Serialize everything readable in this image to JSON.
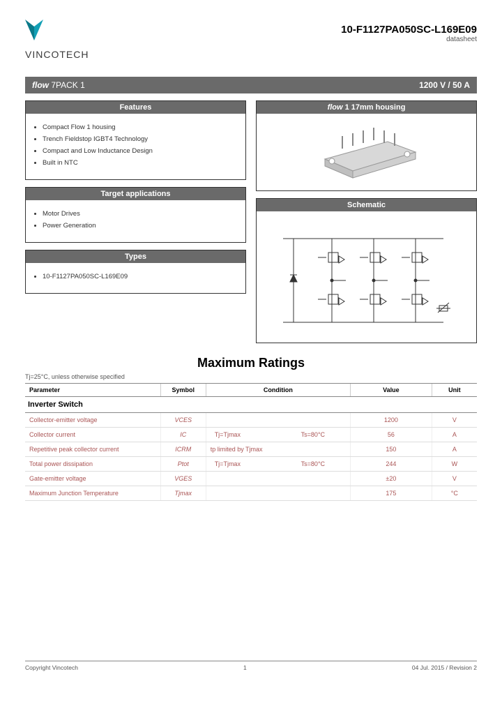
{
  "brand": "VINCOTECH",
  "part_number": "10-F1127PA050SC-L169E09",
  "doc_type": "datasheet",
  "banner": {
    "product_line": "flow 7PACK 1",
    "rating": "1200 V / 50 A"
  },
  "boxes": {
    "features": {
      "title": "Features",
      "items": [
        "Compact Flow 1 housing",
        "Trench Fieldstop IGBT4 Technology",
        "Compact and Low Inductance Design",
        "Built in NTC"
      ]
    },
    "target_apps": {
      "title": "Target applications",
      "items": [
        "Motor Drives",
        "Power Generation"
      ]
    },
    "types": {
      "title": "Types",
      "items": [
        "10-F1127PA050SC-L169E09"
      ]
    },
    "housing": {
      "title": "flow 1 17mm housing"
    },
    "schematic": {
      "title": "Schematic"
    }
  },
  "max_ratings": {
    "title": "Maximum Ratings",
    "note": "Tj=25°C, unless otherwise specified",
    "headers": [
      "Parameter",
      "Symbol",
      "Condition",
      "Value",
      "Unit"
    ],
    "subsection": "Inverter Switch",
    "rows": [
      {
        "param": "Collector-emitter voltage",
        "symbol": "VCES",
        "cond1": "",
        "cond2": "",
        "value": "1200",
        "unit": "V"
      },
      {
        "param": "Collector current",
        "symbol": "IC",
        "cond1": "Tj=Tjmax",
        "cond2": "Ts=80°C",
        "value": "56",
        "unit": "A"
      },
      {
        "param": "Repetitive peak collector current",
        "symbol": "ICRM",
        "cond1": "tp limited by Tjmax",
        "cond2": "",
        "value": "150",
        "unit": "A"
      },
      {
        "param": "Total power dissipation",
        "symbol": "Ptot",
        "cond1": "Tj=Tjmax",
        "cond2": "Ts=80°C",
        "value": "244",
        "unit": "W"
      },
      {
        "param": "Gate-emitter voltage",
        "symbol": "VGES",
        "cond1": "",
        "cond2": "",
        "value": "±20",
        "unit": "V"
      },
      {
        "param": "Maximum Junction Temperature",
        "symbol": "Tjmax",
        "cond1": "",
        "cond2": "",
        "value": "175",
        "unit": "°C"
      }
    ]
  },
  "footer": {
    "copyright": "Copyright Vincotech",
    "page": "1",
    "date_rev": "04 Jul. 2015 / Revision 2"
  }
}
